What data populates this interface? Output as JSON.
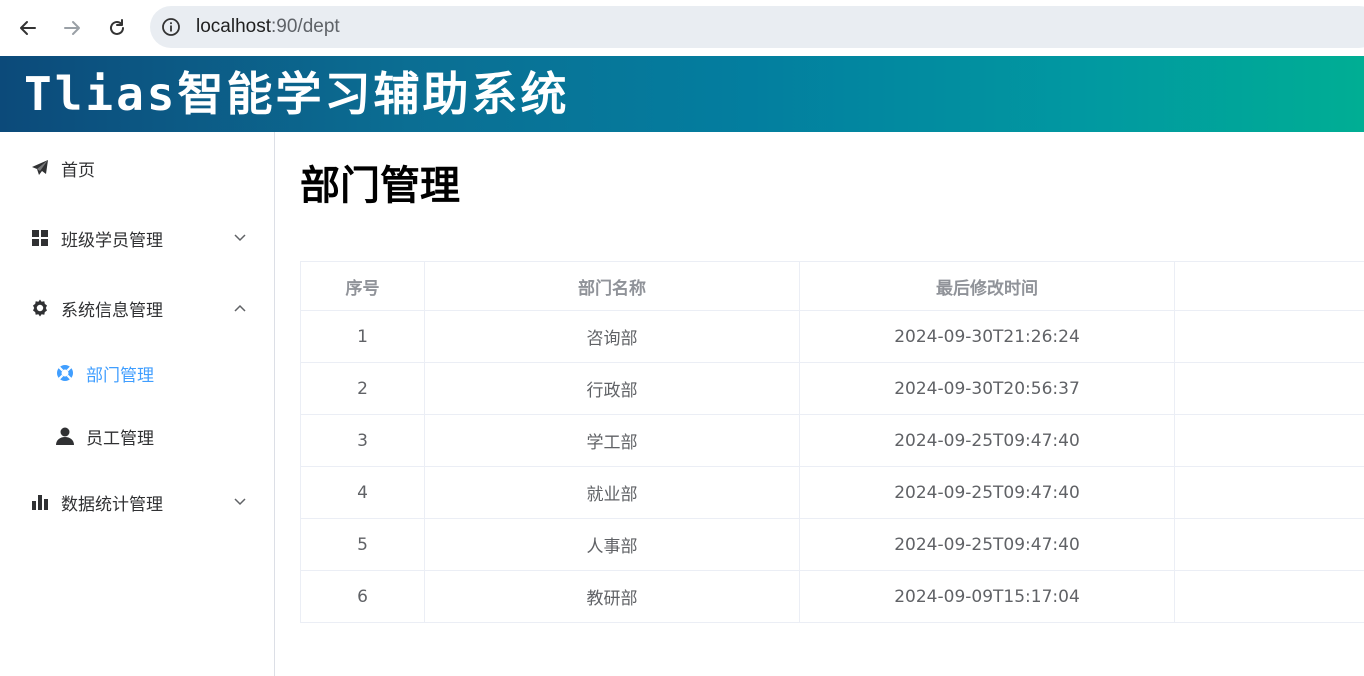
{
  "browser": {
    "url_host": "localhost",
    "url_path": ":90/dept"
  },
  "app": {
    "title": "Tlias智能学习辅助系统"
  },
  "sidebar": {
    "items": [
      {
        "label": "首页",
        "icon": "paper-plane-icon"
      },
      {
        "label": "班级学员管理",
        "icon": "grid-icon",
        "expanded": false
      },
      {
        "label": "系统信息管理",
        "icon": "gear-icon",
        "expanded": true
      },
      {
        "label": "部门管理",
        "icon": "help-buoy-icon",
        "active": true
      },
      {
        "label": "员工管理",
        "icon": "user-icon"
      },
      {
        "label": "数据统计管理",
        "icon": "bar-chart-icon",
        "expanded": false
      }
    ]
  },
  "main": {
    "title": "部门管理",
    "table": {
      "headers": [
        "序号",
        "部门名称",
        "最后修改时间",
        ""
      ],
      "rows": [
        [
          "1",
          "咨询部",
          "2024-09-30T21:26:24"
        ],
        [
          "2",
          "行政部",
          "2024-09-30T20:56:37"
        ],
        [
          "3",
          "学工部",
          "2024-09-25T09:47:40"
        ],
        [
          "4",
          "就业部",
          "2024-09-25T09:47:40"
        ],
        [
          "5",
          "人事部",
          "2024-09-25T09:47:40"
        ],
        [
          "6",
          "教研部",
          "2024-09-09T15:17:04"
        ]
      ]
    }
  },
  "colors": {
    "accent": "#409eff",
    "header_gradient_start": "#0c4a7a",
    "header_gradient_end": "#00ae94"
  }
}
